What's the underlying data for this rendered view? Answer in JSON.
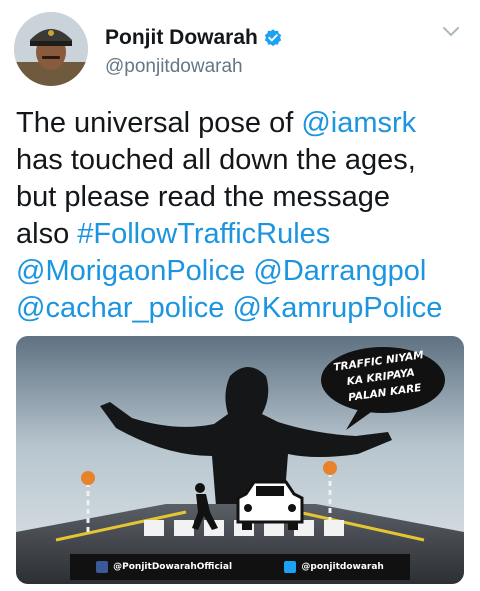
{
  "user": {
    "display_name": "Ponjit Dowarah",
    "handle": "@ponjitdowarah",
    "verified": true
  },
  "tweet": {
    "lines": [
      [
        {
          "text": "The universal pose of ",
          "link": false
        },
        {
          "text": "@iamsrk",
          "link": true
        }
      ],
      [
        {
          "text": "has touched all down the ages,",
          "link": false
        }
      ],
      [
        {
          "text": "but please read the message",
          "link": false
        }
      ],
      [
        {
          "text": "also ",
          "link": false
        },
        {
          "text": "#FollowTrafficRules",
          "link": true
        }
      ],
      [
        {
          "text": "@MorigaonPolice",
          "link": true
        },
        {
          "text": " ",
          "link": false
        },
        {
          "text": "@Darrangpol",
          "link": true
        }
      ],
      [
        {
          "text": "@cachar_police",
          "link": true
        },
        {
          "text": " ",
          "link": false
        },
        {
          "text": "@KamrupPolice",
          "link": true
        }
      ]
    ]
  },
  "media": {
    "bubble_lines": [
      "TRAFFIC NIYAM",
      "KA KRIPAYA",
      "PALAN KARE"
    ],
    "facebook_handle": "@PonjitDowarahOfficial",
    "twitter_handle": "@ponjitdowarah"
  },
  "colors": {
    "link": "#1b95e0",
    "text": "#14171a",
    "secondary": "#657786",
    "verified": "#1da1f2"
  },
  "icons": {
    "verified": "verified-badge-icon",
    "menu": "chevron-down-icon",
    "facebook": "facebook-icon",
    "twitter": "twitter-icon"
  }
}
